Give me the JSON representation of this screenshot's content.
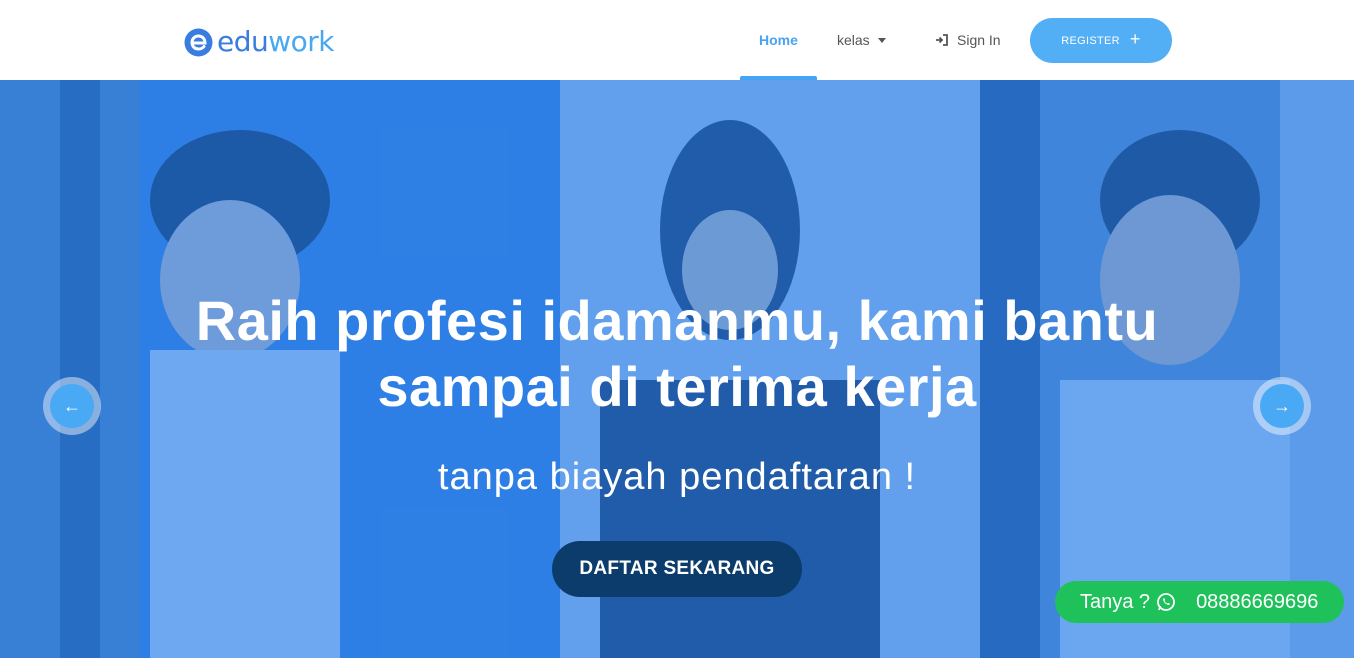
{
  "brand": {
    "part1": "edu",
    "part2": "work"
  },
  "nav": {
    "home": "Home",
    "kelas": "kelas",
    "signin": "Sign In",
    "register": "REGISTER",
    "register_icon": "plus-icon"
  },
  "hero": {
    "headline_line1": "Raih profesi idamanmu, kami bantu",
    "headline_line2": "sampai di terima kerja",
    "subline": "tanpa biayah pendaftaran !",
    "cta": "DAFTAR SEKARANG",
    "prev_icon": "arrow-left-icon",
    "next_icon": "arrow-right-icon"
  },
  "whatsapp": {
    "label": "Tanya ?",
    "phone": "08886669696",
    "icon": "whatsapp-icon"
  },
  "colors": {
    "primary": "#47a3f3",
    "register_bg": "#52aef5",
    "cta_bg": "#0b3c6b",
    "whatsapp_bg": "#1fc15a",
    "hero_overlay": "#2480f2"
  }
}
